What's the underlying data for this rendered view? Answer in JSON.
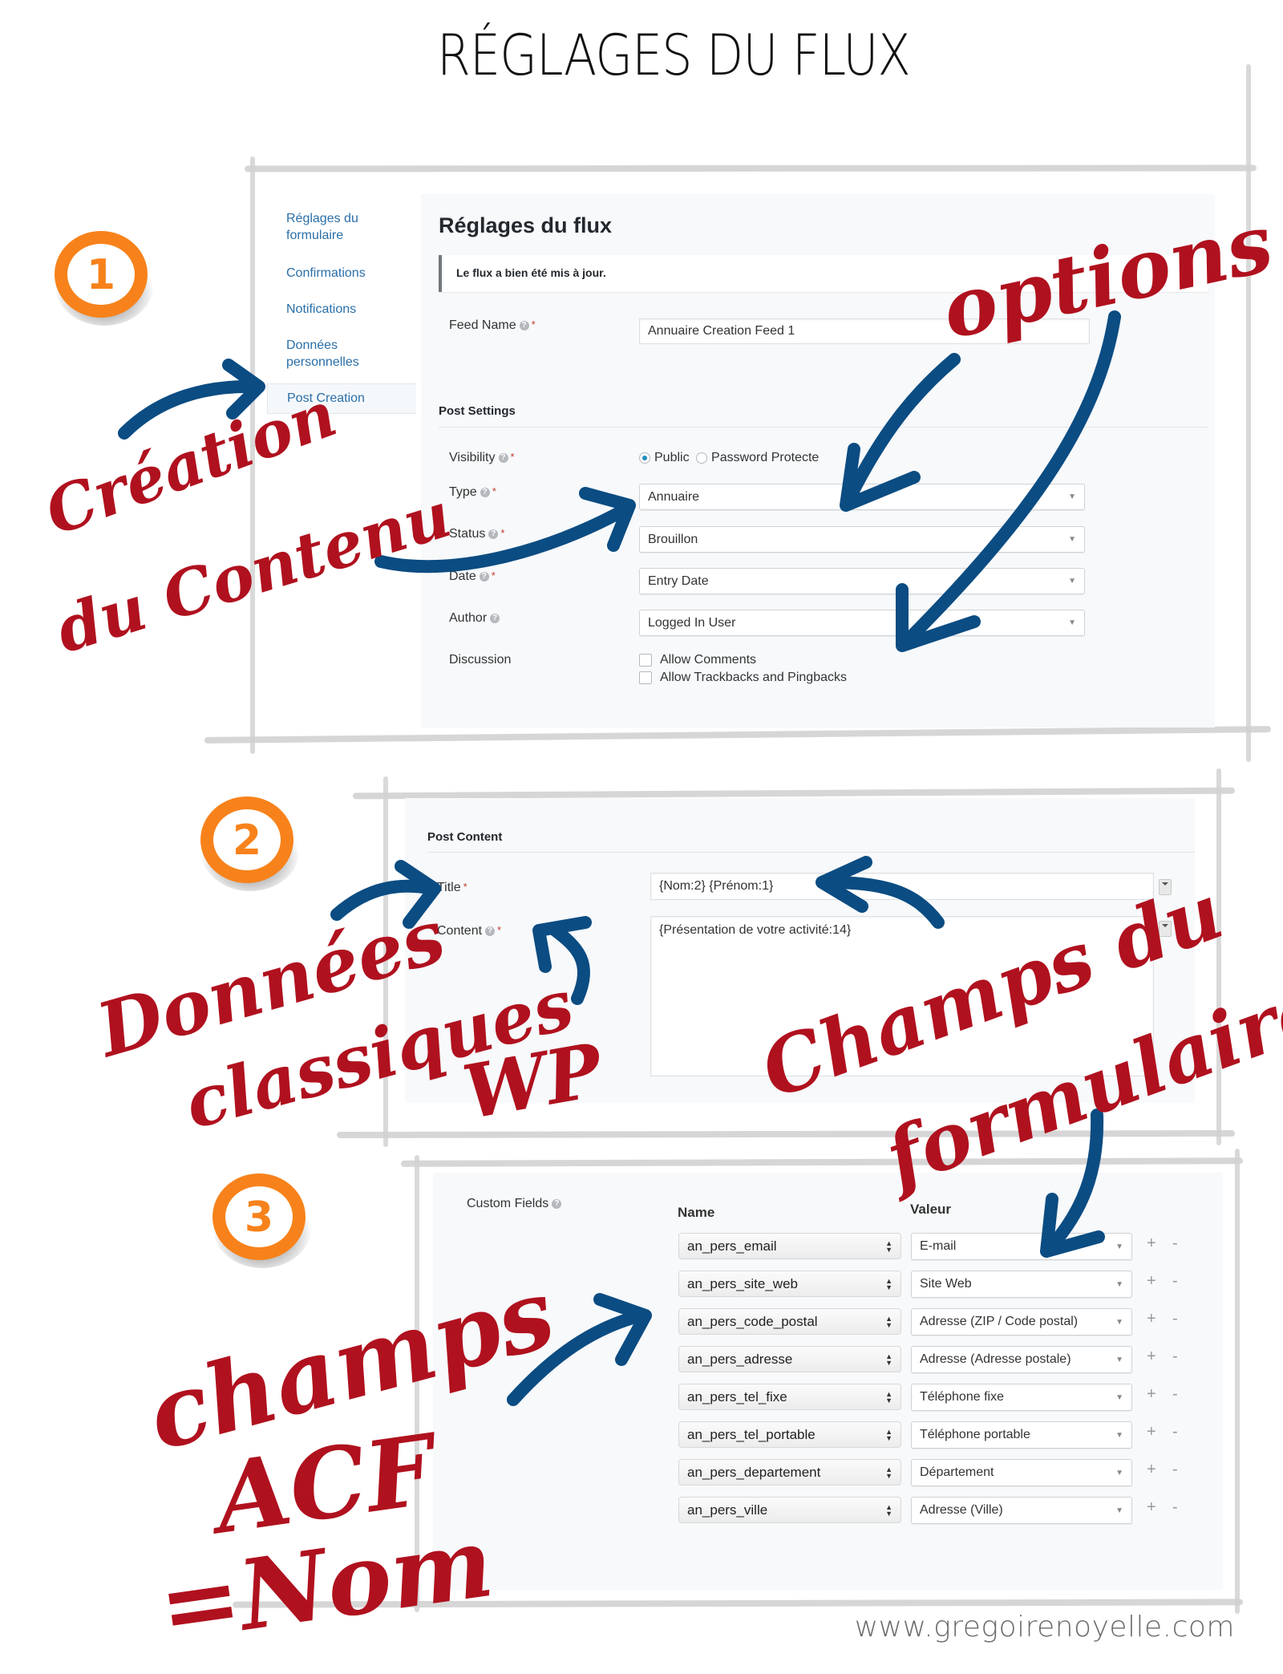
{
  "page": {
    "title": "RÉGLAGES DU FLUX",
    "footer_url": "www.gregoirenoyelle.com"
  },
  "colors": {
    "annotation_red": "#b0111e",
    "arrow_blue": "#0b4c82",
    "badge_orange": "#f7821b",
    "link_blue": "#2a6fa8"
  },
  "badges": [
    "1",
    "2",
    "3"
  ],
  "annotations": {
    "creation_contenu": [
      "Création",
      "du Contenu"
    ],
    "options": "options",
    "donnees_classiques": [
      "Données",
      "classiques",
      "WP"
    ],
    "champs_formulaire": [
      "Champs du",
      "formulaire"
    ],
    "champs_acf": [
      "champs",
      "ACF",
      "=Nom"
    ]
  },
  "sidebar": {
    "items": [
      {
        "label": "Réglages du formulaire",
        "active": false
      },
      {
        "label": "Confirmations",
        "active": false
      },
      {
        "label": "Notifications",
        "active": false
      },
      {
        "label": "Données personnelles",
        "active": false
      },
      {
        "label": "Post Creation",
        "active": true
      }
    ]
  },
  "feed_settings": {
    "heading": "Réglages du flux",
    "notice": "Le flux a bien été mis à jour.",
    "feed_name": {
      "label": "Feed Name",
      "value": "Annuaire Creation Feed 1",
      "required": true
    },
    "post_settings_title": "Post Settings",
    "visibility": {
      "label": "Visibility",
      "options": [
        "Public",
        "Password Protecte"
      ],
      "selected": "Public",
      "required": true
    },
    "type": {
      "label": "Type",
      "value": "Annuaire",
      "required": true
    },
    "status": {
      "label": "Status",
      "value": "Brouillon",
      "required": true
    },
    "date": {
      "label": "Date",
      "value": "Entry Date",
      "required": true
    },
    "author": {
      "label": "Author",
      "value": "Logged In User",
      "required": false
    },
    "discussion": {
      "label": "Discussion",
      "options": [
        {
          "label": "Allow Comments",
          "checked": false
        },
        {
          "label": "Allow Trackbacks and Pingbacks",
          "checked": false
        }
      ]
    }
  },
  "post_content": {
    "title": "Post Content",
    "title_field": {
      "label": "Title",
      "value": "{Nom:2} {Prénom:1}",
      "required": true
    },
    "content_field": {
      "label": "Content",
      "value": "{Présentation de votre activité:14}",
      "required": true
    }
  },
  "custom_fields": {
    "label": "Custom Fields",
    "col_name": "Name",
    "col_value": "Valeur",
    "add_symbol": "+",
    "remove_symbol": "-",
    "rows": [
      {
        "name": "an_pers_email",
        "value": "E-mail"
      },
      {
        "name": "an_pers_site_web",
        "value": "Site Web"
      },
      {
        "name": "an_pers_code_postal",
        "value": "Adresse (ZIP / Code postal)"
      },
      {
        "name": "an_pers_adresse",
        "value": "Adresse (Adresse postale)"
      },
      {
        "name": "an_pers_tel_fixe",
        "value": "Téléphone fixe"
      },
      {
        "name": "an_pers_tel_portable",
        "value": "Téléphone portable"
      },
      {
        "name": "an_pers_departement",
        "value": "Département"
      },
      {
        "name": "an_pers_ville",
        "value": "Adresse (Ville)"
      }
    ]
  }
}
